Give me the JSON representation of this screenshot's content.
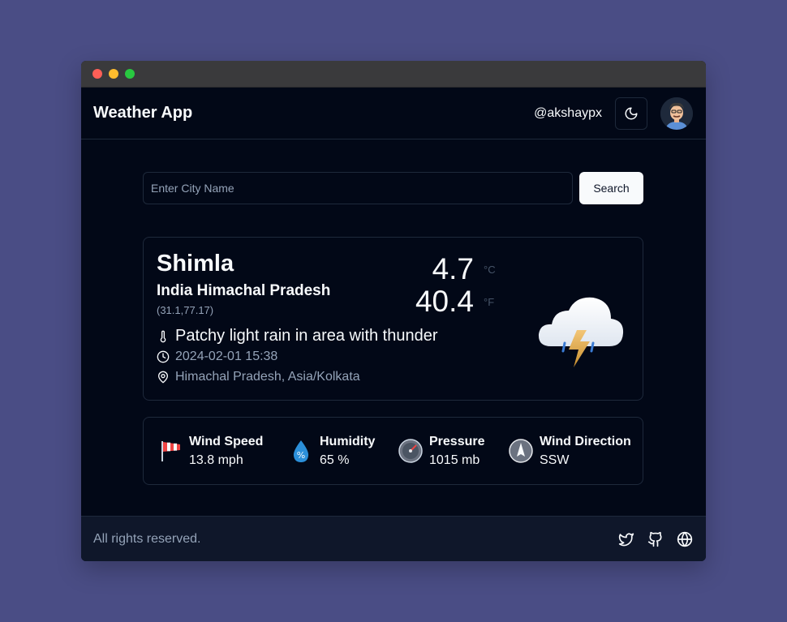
{
  "header": {
    "title": "Weather App",
    "username": "@akshaypx",
    "theme_icon": "moon-icon",
    "avatar_icon": "avatar-cartoon-icon"
  },
  "search": {
    "placeholder": "Enter City Name",
    "value": "",
    "button_label": "Search"
  },
  "weather": {
    "city": "Shimla",
    "region": "India Himachal Pradesh",
    "coords": "(31.1,77.17)",
    "temp_c": "4.7",
    "unit_c": "°C",
    "temp_f": "40.4",
    "unit_f": "°F",
    "condition": "Patchy light rain in area with thunder",
    "datetime": "2024-02-01 15:38",
    "location": "Himachal Pradesh, Asia/Kolkata",
    "condition_icon": "thunderstorm-cloud-icon"
  },
  "stats": [
    {
      "label": "Wind Speed",
      "value": "13.8 mph",
      "icon": "windsock-icon"
    },
    {
      "label": "Humidity",
      "value": "65 %",
      "icon": "humidity-drop-icon"
    },
    {
      "label": "Pressure",
      "value": "1015 mb",
      "icon": "pressure-gauge-icon"
    },
    {
      "label": "Wind Direction",
      "value": "SSW",
      "icon": "compass-icon"
    }
  ],
  "footer": {
    "text": "All rights reserved.",
    "icons": [
      "twitter-icon",
      "github-icon",
      "globe-icon"
    ]
  },
  "colors": {
    "page_bg": "#4a4d85",
    "app_bg": "#020817",
    "footer_bg": "#0f172a",
    "border": "#1e293b",
    "text": "#f8fafc",
    "muted": "#94a3b8"
  }
}
